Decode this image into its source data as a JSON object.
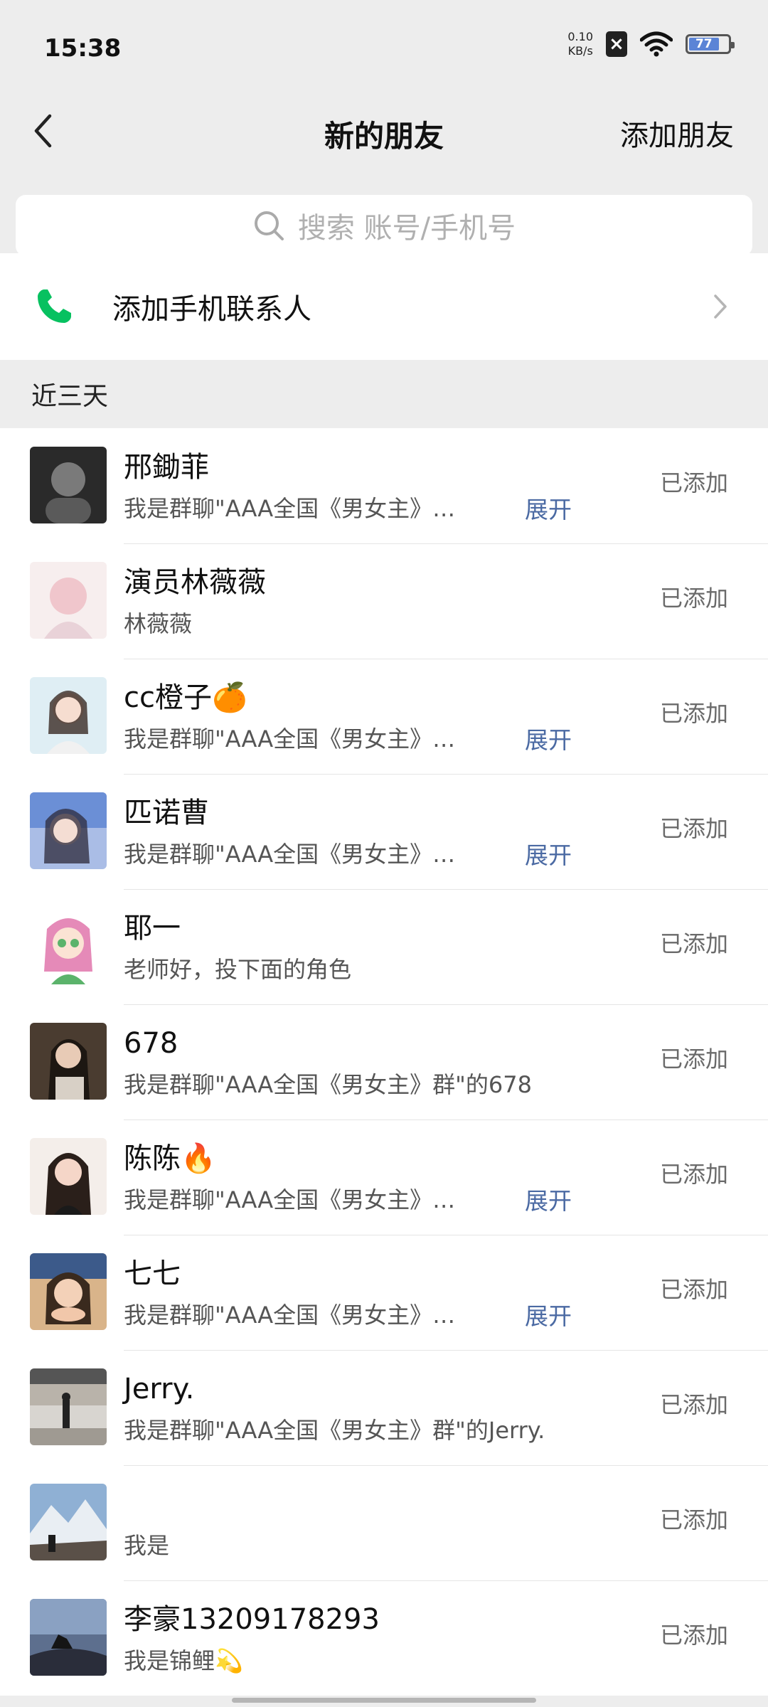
{
  "status_bar": {
    "time": "15:38",
    "net_speed_value": "0.10",
    "net_speed_unit": "KB/s",
    "x_badge": "×",
    "battery_level": "77"
  },
  "nav": {
    "title": "新的朋友",
    "add_friend": "添加朋友",
    "back_icon": "chevron-left-icon"
  },
  "search": {
    "placeholder": "搜索 账号/手机号",
    "icon": "search-icon"
  },
  "phone_contacts": {
    "label": "添加手机联系人",
    "icon": "phone-icon",
    "accent": "#07c160"
  },
  "section": {
    "title": "近三天"
  },
  "friends": [
    {
      "name": "邢鋤菲",
      "message": "我是群聊\"AAA全国《男女主》…",
      "expand": "展开",
      "status": "已添加"
    },
    {
      "name": "演员林薇薇",
      "message": "林薇薇",
      "expand": "",
      "status": "已添加"
    },
    {
      "name": "cc橙子🍊",
      "message": "我是群聊\"AAA全国《男女主》…",
      "expand": "展开",
      "status": "已添加"
    },
    {
      "name": "匹诺曹",
      "message": "我是群聊\"AAA全国《男女主》…",
      "expand": "展开",
      "status": "已添加"
    },
    {
      "name": "耶一",
      "message": "老师好，投下面的角色",
      "expand": "",
      "status": "已添加"
    },
    {
      "name": "678",
      "message": "我是群聊\"AAA全国《男女主》群\"的678",
      "expand": "",
      "status": "已添加"
    },
    {
      "name": "陈陈🔥",
      "message": "我是群聊\"AAA全国《男女主》…",
      "expand": "展开",
      "status": "已添加"
    },
    {
      "name": "七七",
      "message": "我是群聊\"AAA全国《男女主》…",
      "expand": "展开",
      "status": "已添加"
    },
    {
      "name": "Jerry.",
      "message": "我是群聊\"AAA全国《男女主》群\"的Jerry.",
      "expand": "",
      "status": "已添加"
    },
    {
      "name": "",
      "message": "我是",
      "expand": "",
      "status": "已添加"
    },
    {
      "name": "李豪13209178293",
      "message": "我是锦鲤💫",
      "expand": "",
      "status": "已添加"
    }
  ],
  "colors": {
    "background": "#ededed",
    "link": "#4b6aa3",
    "status_text": "#6a6a6a"
  }
}
